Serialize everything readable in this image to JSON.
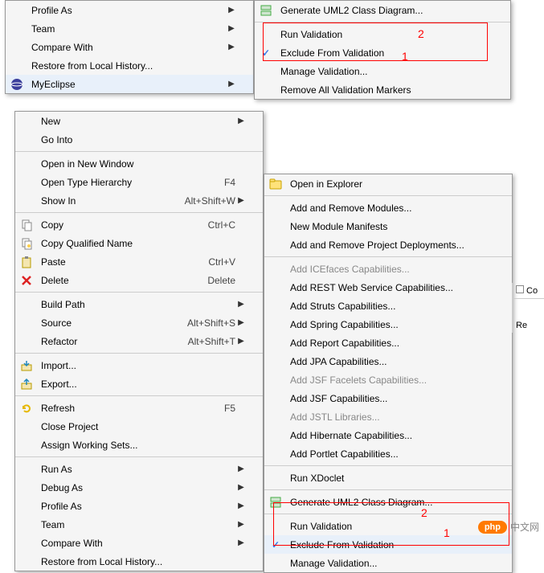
{
  "topLeft": {
    "items": [
      {
        "label": "Profile As",
        "arrow": true
      },
      {
        "label": "Team",
        "arrow": true
      },
      {
        "label": "Compare With",
        "arrow": true
      },
      {
        "label": "Restore from Local History..."
      },
      {
        "label": "MyEclipse",
        "arrow": true,
        "highlighted": true,
        "eclipseIcon": true
      }
    ]
  },
  "topRight": {
    "items": [
      {
        "icon": "uml-icon",
        "label": "Generate UML2 Class Diagram..."
      },
      {
        "sep": true
      },
      {
        "label": "Run Validation"
      },
      {
        "check": true,
        "label": "Exclude From Validation"
      },
      {
        "label": "Manage Validation..."
      },
      {
        "label": "Remove All Validation Markers"
      }
    ]
  },
  "midLeft": {
    "items": [
      {
        "label": "New",
        "arrow": true
      },
      {
        "label": "Go Into"
      },
      {
        "sep": true
      },
      {
        "label": "Open in New Window"
      },
      {
        "label": "Open Type Hierarchy",
        "shortcut": "F4"
      },
      {
        "label": "Show In",
        "shortcut": "Alt+Shift+W",
        "arrow": true
      },
      {
        "sep": true
      },
      {
        "icon": "copy-icon",
        "label": "Copy",
        "shortcut": "Ctrl+C"
      },
      {
        "icon": "copy-qn-icon",
        "label": "Copy Qualified Name"
      },
      {
        "icon": "paste-icon",
        "label": "Paste",
        "shortcut": "Ctrl+V"
      },
      {
        "icon": "delete-icon",
        "label": "Delete",
        "shortcut": "Delete"
      },
      {
        "sep": true
      },
      {
        "label": "Build Path",
        "arrow": true
      },
      {
        "label": "Source",
        "shortcut": "Alt+Shift+S",
        "arrow": true
      },
      {
        "label": "Refactor",
        "shortcut": "Alt+Shift+T",
        "arrow": true
      },
      {
        "sep": true
      },
      {
        "icon": "import-icon",
        "label": "Import..."
      },
      {
        "icon": "export-icon",
        "label": "Export..."
      },
      {
        "sep": true
      },
      {
        "icon": "refresh-icon",
        "label": "Refresh",
        "shortcut": "F5"
      },
      {
        "label": "Close Project"
      },
      {
        "label": "Assign Working Sets..."
      },
      {
        "sep": true
      },
      {
        "label": "Run As",
        "arrow": true
      },
      {
        "label": "Debug As",
        "arrow": true
      },
      {
        "label": "Profile As",
        "arrow": true
      },
      {
        "label": "Team",
        "arrow": true
      },
      {
        "label": "Compare With",
        "arrow": true
      },
      {
        "label": "Restore from Local History..."
      }
    ]
  },
  "midRight": {
    "items": [
      {
        "icon": "explorer-icon",
        "label": "Open in Explorer"
      },
      {
        "sep": true
      },
      {
        "label": "Add and Remove Modules..."
      },
      {
        "label": "New Module Manifests"
      },
      {
        "label": "Add and Remove Project Deployments..."
      },
      {
        "sep": true
      },
      {
        "label": "Add ICEfaces Capabilities...",
        "disabled": true
      },
      {
        "label": "Add REST Web Service Capabilities..."
      },
      {
        "label": "Add Struts Capabilities..."
      },
      {
        "label": "Add Spring Capabilities..."
      },
      {
        "label": "Add Report Capabilities..."
      },
      {
        "label": "Add JPA Capabilities..."
      },
      {
        "label": "Add JSF Facelets Capabilities...",
        "disabled": true
      },
      {
        "label": "Add JSF Capabilities..."
      },
      {
        "label": "Add JSTL Libraries...",
        "disabled": true
      },
      {
        "label": "Add Hibernate Capabilities..."
      },
      {
        "label": "Add Portlet Capabilities..."
      },
      {
        "sep": true
      },
      {
        "label": "Run XDoclet"
      },
      {
        "sep": true
      },
      {
        "icon": "uml-icon",
        "label": "Generate UML2 Class Diagram..."
      },
      {
        "sep": true
      },
      {
        "label": "Run Validation"
      },
      {
        "check": true,
        "label": "Exclude From Validation",
        "highlighted": true
      },
      {
        "label": "Manage Validation..."
      }
    ]
  },
  "anno": {
    "top": {
      "n1": "1",
      "n2": "2"
    },
    "bot": {
      "n1": "1",
      "n2": "2"
    }
  },
  "side": {
    "co": "Co",
    "re": "Re"
  },
  "watermark": {
    "badge": "php",
    "text": "中文网"
  }
}
